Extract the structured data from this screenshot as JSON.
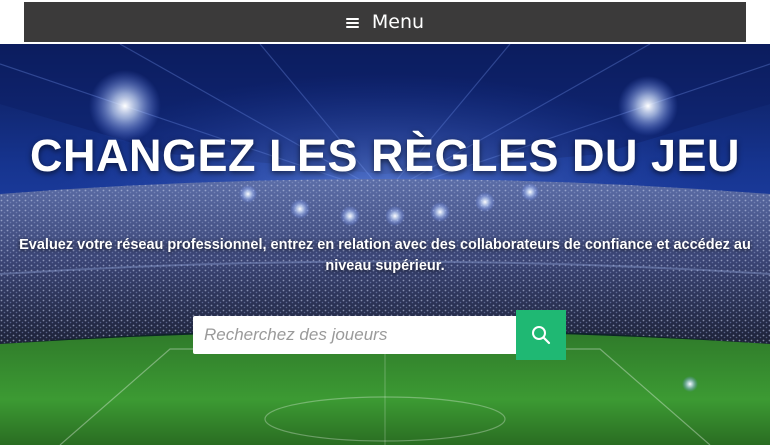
{
  "nav": {
    "menu_label": "Menu",
    "menu_icon": "hamburger-icon",
    "bar_color": "#3b3a3a"
  },
  "hero": {
    "title": "CHANGEZ LES RÈGLES DU JEU",
    "subtitle": "Evaluez votre réseau professionnel, entrez en relation avec des collaborateurs de confiance et accédez au niveau supérieur.",
    "background": "stadium-image"
  },
  "search": {
    "placeholder": "Recherchez des joueurs",
    "value": "",
    "button_icon": "search-icon",
    "button_color": "#1fb873"
  }
}
